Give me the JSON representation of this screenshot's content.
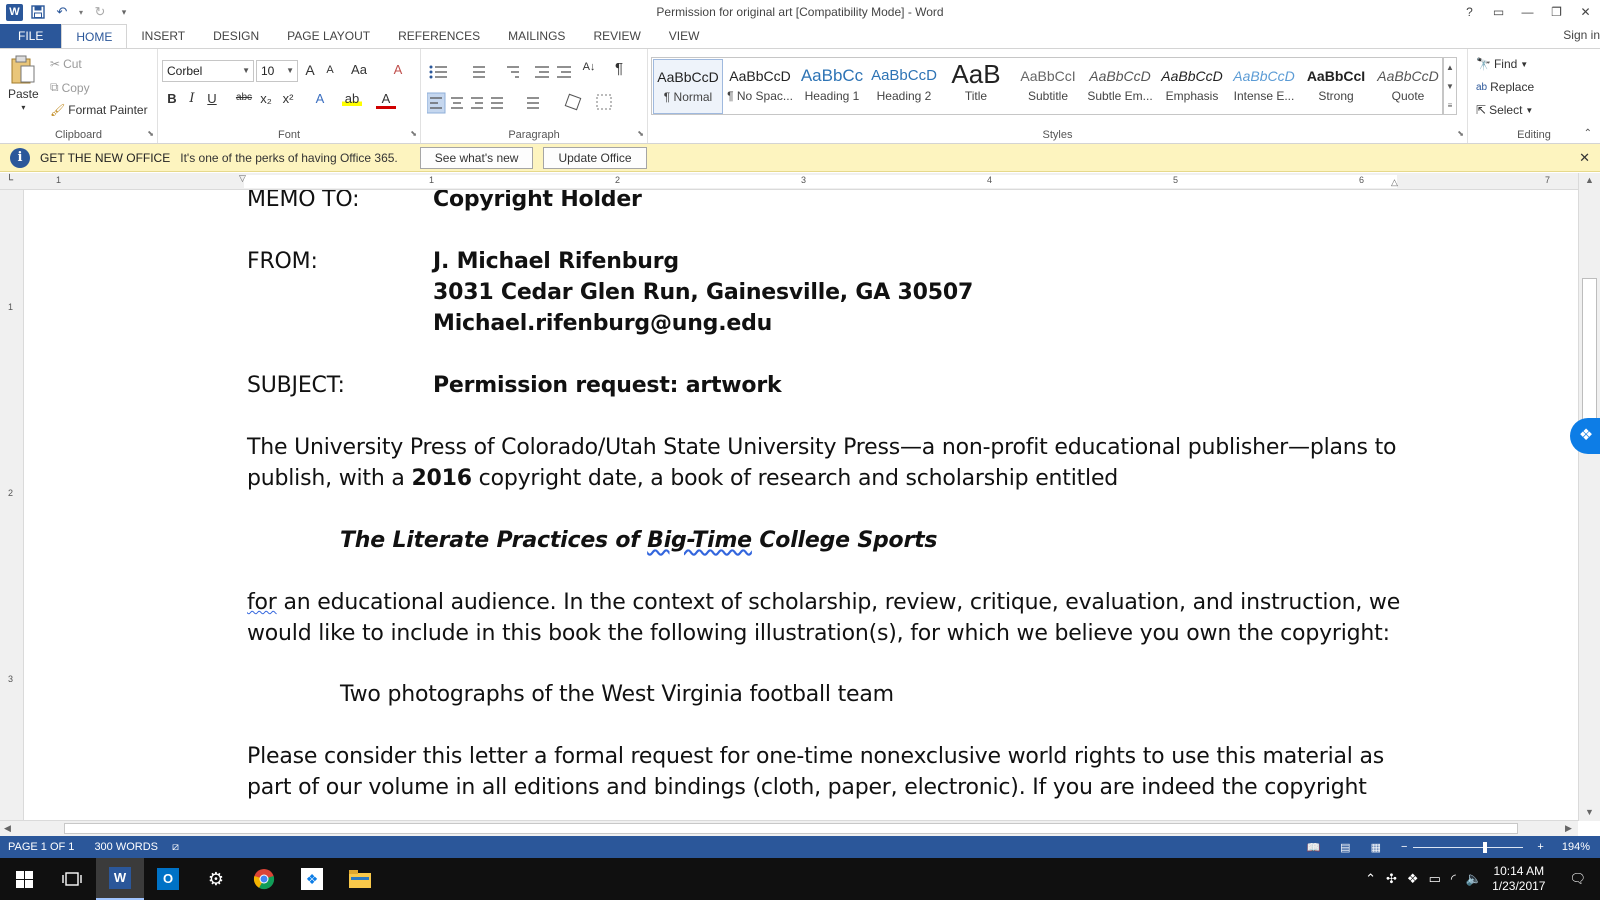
{
  "title_bar": {
    "title": "Permission for original art [Compatibility Mode] - Word",
    "help": "?",
    "ribbon_display": "▭",
    "minimize": "—",
    "restore": "❐",
    "close": "✕"
  },
  "quick_access": {
    "app_icon": "W",
    "save": "💾",
    "undo": "↶",
    "undo_dd": "▾",
    "redo": "↻",
    "customize": "▾"
  },
  "tabs": [
    "FILE",
    "HOME",
    "INSERT",
    "DESIGN",
    "PAGE LAYOUT",
    "REFERENCES",
    "MAILINGS",
    "REVIEW",
    "VIEW"
  ],
  "active_tab": "HOME",
  "sign_in": "Sign in",
  "ribbon": {
    "clipboard": {
      "label": "Clipboard",
      "paste": "Paste",
      "cut": "Cut",
      "copy": "Copy",
      "format_painter": "Format Painter"
    },
    "font": {
      "label": "Font",
      "font_name": "Corbel",
      "font_size": "10",
      "grow": "A",
      "shrink": "A",
      "change_case": "Aa",
      "clear": "A",
      "bold": "B",
      "italic": "I",
      "underline": "U",
      "strike": "abc",
      "subscript": "x₂",
      "superscript": "x²",
      "effects": "A",
      "highlight": "ab",
      "color": "A"
    },
    "paragraph": {
      "label": "Paragraph",
      "show_marks": "¶",
      "sort": "A↓"
    },
    "styles": {
      "label": "Styles",
      "items": [
        {
          "preview": "AaBbCcD",
          "name": "¶ Normal"
        },
        {
          "preview": "AaBbCcD",
          "name": "¶ No Spac..."
        },
        {
          "preview": "AaBbCc",
          "name": "Heading 1"
        },
        {
          "preview": "AaBbCcD",
          "name": "Heading 2"
        },
        {
          "preview": "AaB",
          "name": "Title"
        },
        {
          "preview": "AaBbCcI",
          "name": "Subtitle"
        },
        {
          "preview": "AaBbCcD",
          "name": "Subtle Em..."
        },
        {
          "preview": "AaBbCcD",
          "name": "Emphasis"
        },
        {
          "preview": "AaBbCcD",
          "name": "Intense E..."
        },
        {
          "preview": "AaBbCcI",
          "name": "Strong"
        },
        {
          "preview": "AaBbCcD",
          "name": "Quote"
        }
      ]
    },
    "editing": {
      "label": "Editing",
      "find": "Find",
      "replace": "Replace",
      "select": "Select"
    }
  },
  "infobar": {
    "heading": "GET THE NEW OFFICE",
    "message": "It's one of the perks of having Office 365.",
    "button1": "See what's new",
    "button2": "Update Office"
  },
  "ruler": {
    "h_numbers": [
      "1",
      "1",
      "2",
      "3",
      "4",
      "5",
      "6",
      "7"
    ],
    "v_numbers": [
      "1",
      "2",
      "3"
    ]
  },
  "document": {
    "memo_to_label": "MEMO TO:",
    "memo_to_value": "Copyright Holder",
    "from_label": "FROM:",
    "from_name": "J. Michael Rifenburg",
    "from_address": "3031 Cedar Glen Run, Gainesville, GA 30507",
    "from_email": "Michael.rifenburg@ung.edu",
    "subject_label": "SUBJECT:",
    "subject_value": "Permission request: artwork",
    "para1_line1": "The University Press of Colorado/Utah State University Press—a non-profit educational publisher—plans to",
    "para1_line2_a": "publish, with a ",
    "para1_line2_year": "2016",
    "para1_line2_b": " copyright date, a book of research and scholarship entitled",
    "book_title_a": "The Literate Practices of ",
    "book_title_b": "Big-Time",
    "book_title_c": " College Sports",
    "para2_line1_a": "for",
    "para2_line1_b": " an educational audience. In the context of scholarship, review, critique, evaluation, and instruction, we",
    "para2_line2": "would like to include in this book the following illustration(s), for which we believe you own the copyright:",
    "illustration": "Two photographs of the West Virginia football team",
    "para3_line1": "Please consider this letter a formal request for one-time nonexclusive world rights to use this material as",
    "para3_line2": "part of our volume in all editions and bindings (cloth, paper, electronic). If you are indeed the copyright"
  },
  "status_bar": {
    "page": "PAGE 1 OF 1",
    "words": "300 WORDS",
    "zoom": "194%",
    "zoom_minus": "−",
    "zoom_plus": "+"
  },
  "taskbar": {
    "time": "10:14 AM",
    "date": "1/23/2017"
  }
}
